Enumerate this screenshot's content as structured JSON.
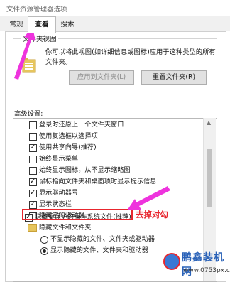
{
  "window": {
    "title": "文件资源管理器选项"
  },
  "tabs": {
    "general": "常规",
    "view": "查看",
    "search": "搜索"
  },
  "folder_view": {
    "legend": "文件夹视图",
    "description": "你可以将此视图(如详细信息或图标)应用于这种类型的所有文件夹。",
    "apply_button": "应用到文件夹(L)",
    "reset_button": "重置文件夹(R)"
  },
  "advanced": {
    "label": "高级设置:",
    "items": [
      {
        "label": "登录时还原上一个文件夹窗口",
        "kind": "checkbox",
        "checked": false
      },
      {
        "label": "使用复选框以选择项",
        "kind": "checkbox",
        "checked": false
      },
      {
        "label": "使用共享向导(推荐)",
        "kind": "checkbox",
        "checked": true
      },
      {
        "label": "始终显示菜单",
        "kind": "checkbox",
        "checked": false
      },
      {
        "label": "始终显示图标，从不显示缩略图",
        "kind": "checkbox",
        "checked": false
      },
      {
        "label": "鼠标指向文件夹和桌面项时显示提示信息",
        "kind": "checkbox",
        "checked": true
      },
      {
        "label": "显示驱动器号",
        "kind": "checkbox",
        "checked": true
      },
      {
        "label": "显示状态栏",
        "kind": "checkbox",
        "checked": true
      },
      {
        "label": "隐藏空的驱动器",
        "kind": "checkbox",
        "checked": false
      },
      {
        "label": "隐藏受保护的操作系统文件(推荐)",
        "kind": "checkbox",
        "checked": true
      },
      {
        "label": "隐藏文件和文件夹",
        "kind": "folder"
      },
      {
        "label": "不显示隐藏的文件、文件夹或驱动器",
        "kind": "radio",
        "selected": false
      },
      {
        "label": "显示隐藏的文件、文件夹和驱动器",
        "kind": "radio",
        "selected": true
      }
    ]
  },
  "annotation": {
    "text": "去掉对勾",
    "color": "#e8262e"
  },
  "watermark": {
    "name": "鹏鑫装机网",
    "url": "www.0753px.com"
  },
  "colors": {
    "accent": "#e8262e",
    "arrow": "#ee33dd"
  }
}
